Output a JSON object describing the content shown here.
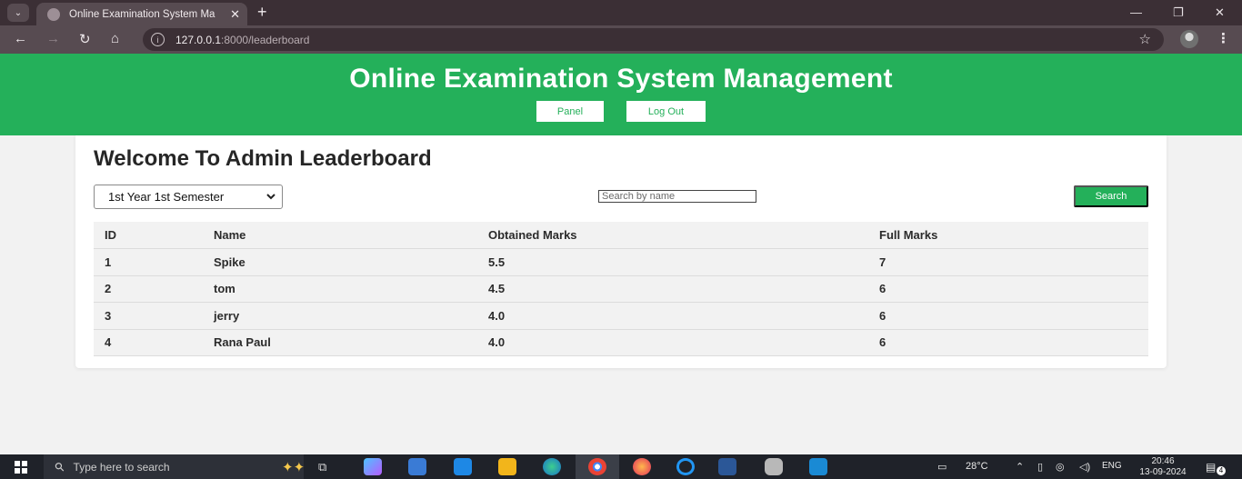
{
  "browser": {
    "tab_title": "Online Examination System Ma",
    "url_host": "127.0.0.1",
    "url_path": ":8000/leaderboard"
  },
  "header": {
    "title": "Online Examination System Management",
    "panel_label": "Panel",
    "logout_label": "Log Out"
  },
  "main": {
    "heading": "Welcome To Admin Leaderboard",
    "semester_selected": "1st Year 1st Semester",
    "search_placeholder": "Search by name",
    "search_label": "Search"
  },
  "table": {
    "headers": [
      "ID",
      "Name",
      "Obtained Marks",
      "Full Marks"
    ],
    "rows": [
      [
        "1",
        "Spike",
        "5.5",
        "7"
      ],
      [
        "2",
        "tom",
        "4.5",
        "6"
      ],
      [
        "3",
        "jerry",
        "4.0",
        "6"
      ],
      [
        "4",
        "Rana Paul",
        "4.0",
        "6"
      ]
    ]
  },
  "taskbar": {
    "search_placeholder": "Type here to search",
    "temperature": "28°C",
    "language": "ENG",
    "time": "20:46",
    "date": "13-09-2024",
    "notification_count": "4"
  },
  "colors": {
    "brand_green": "#24b05a",
    "chrome_dark": "#3b2f35",
    "chrome_mid": "#574b51"
  }
}
